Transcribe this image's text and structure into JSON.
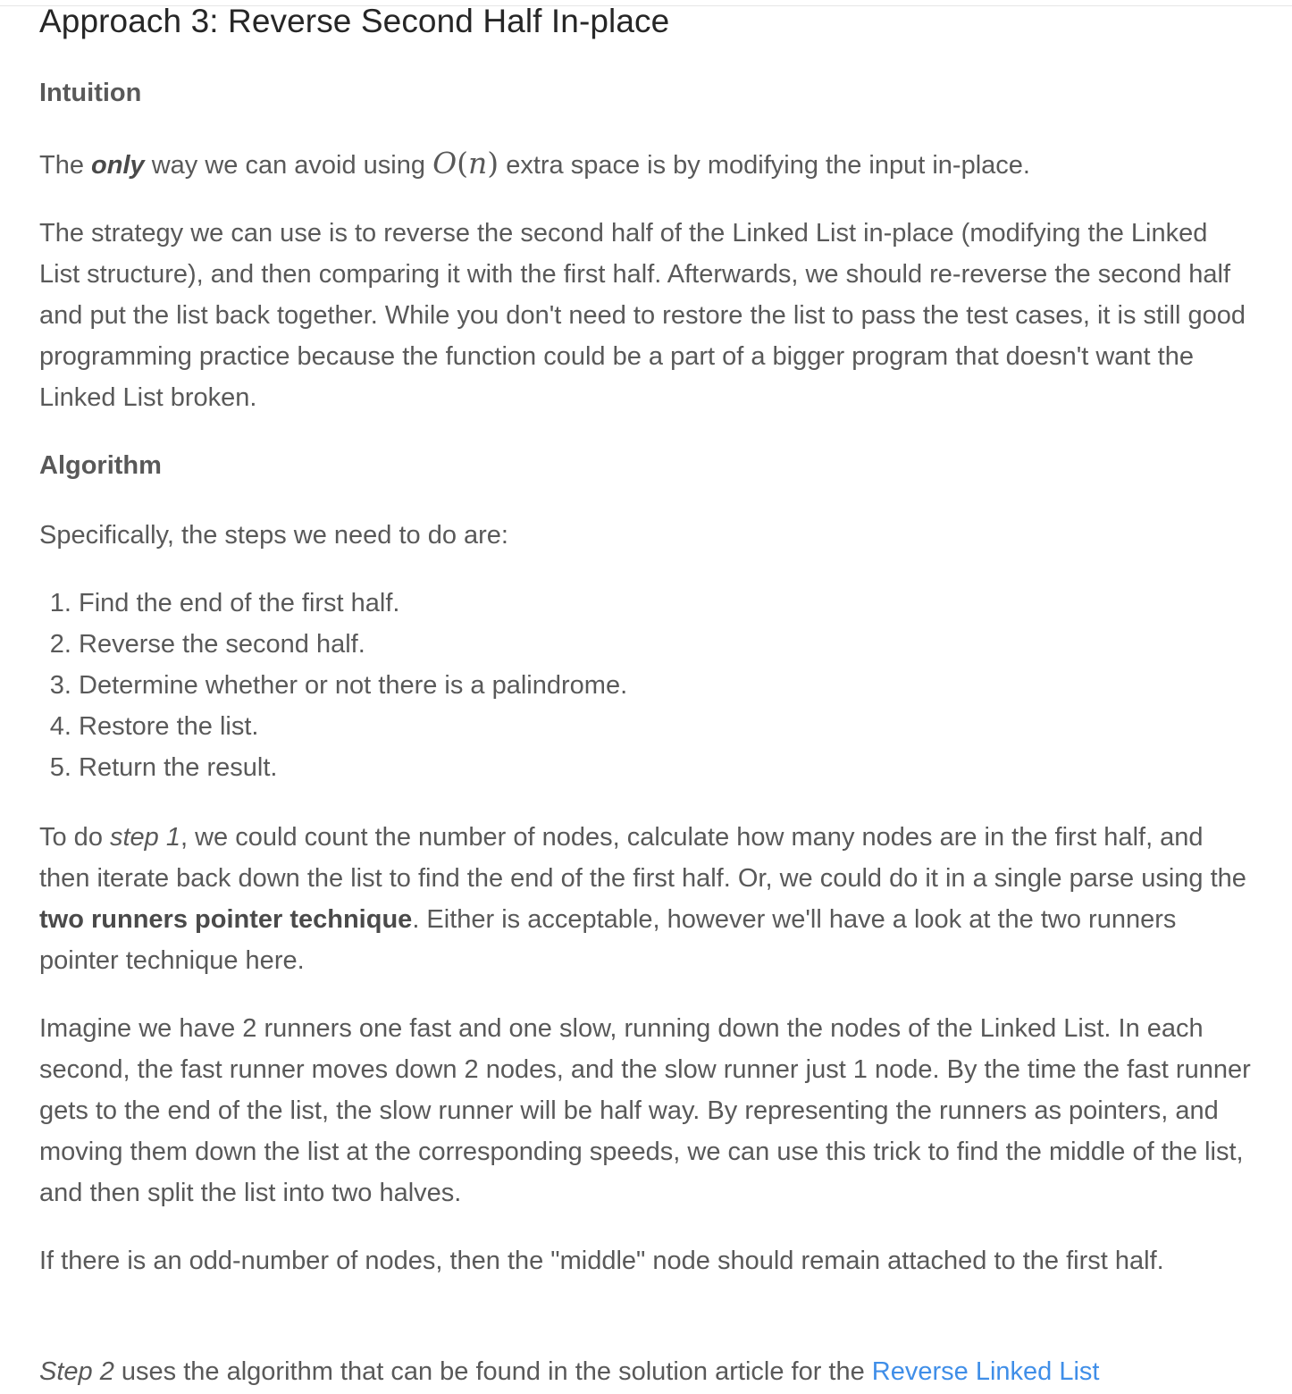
{
  "title": "Approach 3: Reverse Second Half In-place",
  "intuition": {
    "heading": "Intuition",
    "p1": {
      "before": "The ",
      "emph": "only",
      "middle": " way we can avoid using ",
      "math_O": "O",
      "math_open": "(",
      "math_n": "n",
      "math_close": ")",
      "after": " extra space is by modifying the input in-place."
    },
    "p2": "The strategy we can use is to reverse the second half of the Linked List in-place (modifying the Linked List structure), and then comparing it with the first half. Afterwards, we should re-reverse the second half and put the list back together. While you don't need to restore the list to pass the test cases, it is still good programming practice because the function could be a part of a bigger program that doesn't want the Linked List broken."
  },
  "algorithm": {
    "heading": "Algorithm",
    "intro": "Specifically, the steps we need to do are:",
    "steps": [
      "Find the end of the first half.",
      "Reverse the second half.",
      "Determine whether or not there is a palindrome.",
      "Restore the list.",
      "Return the result."
    ],
    "p_step1": {
      "before": "To do ",
      "emph": "step 1",
      "middle": ", we could count the number of nodes, calculate how many nodes are in the first half, and then iterate back down the list to find the end of the first half. Or, we could do it in a single parse using the ",
      "strong": "two runners pointer technique",
      "after": ". Either is acceptable, however we'll have a look at the two runners pointer technique here."
    },
    "p_runners": "Imagine we have 2 runners one fast and one slow, running down the nodes of the Linked List. In each second, the fast runner moves down 2 nodes, and the slow runner just 1 node. By the time the fast runner gets to the end of the list, the slow runner will be half way. By representing the runners as pointers, and moving them down the list at the corresponding speeds, we can use this trick to find the middle of the list, and then split the list into two halves.",
    "p_odd": "If there is an odd-number of nodes, then the \"middle\" node should remain attached to the first half.",
    "p_step2": {
      "emph": "Step 2",
      "middle": " uses the algorithm that can be found in the solution article for the ",
      "link": "Reverse Linked List"
    }
  },
  "colors": {
    "text": "#595959",
    "title": "#262626",
    "link": "#3f8ee8"
  }
}
